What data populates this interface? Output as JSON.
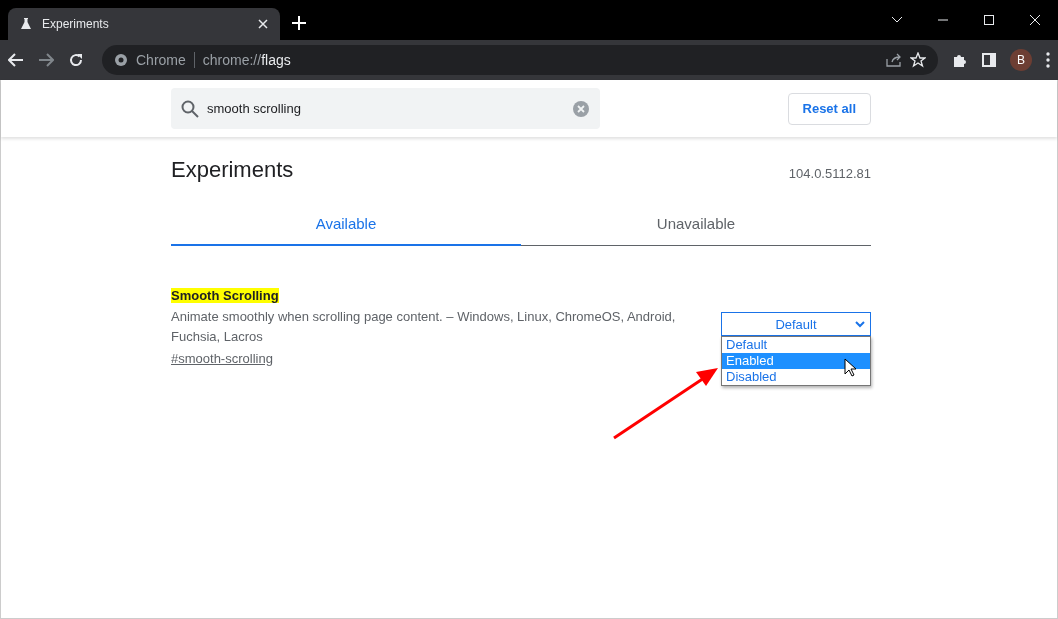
{
  "browser_tab": {
    "title": "Experiments"
  },
  "address_bar": {
    "site_label": "Chrome",
    "url_scheme": "chrome://",
    "url_path": "flags"
  },
  "profile": {
    "initial": "B"
  },
  "search": {
    "value": "smooth scrolling"
  },
  "reset_button": "Reset all",
  "heading": "Experiments",
  "version": "104.0.5112.81",
  "tabs": [
    {
      "label": "Available",
      "selected": true
    },
    {
      "label": "Unavailable",
      "selected": false
    }
  ],
  "flag": {
    "name": "Smooth Scrolling",
    "description": "Animate smoothly when scrolling page content. – Windows, Linux, ChromeOS, Android, Fuchsia, Lacros",
    "link": "#smooth-scrolling",
    "select_value": "Default",
    "dropdown_open": true,
    "options": [
      {
        "label": "Default",
        "selected": false
      },
      {
        "label": "Enabled",
        "selected": true
      },
      {
        "label": "Disabled",
        "selected": false
      }
    ]
  }
}
